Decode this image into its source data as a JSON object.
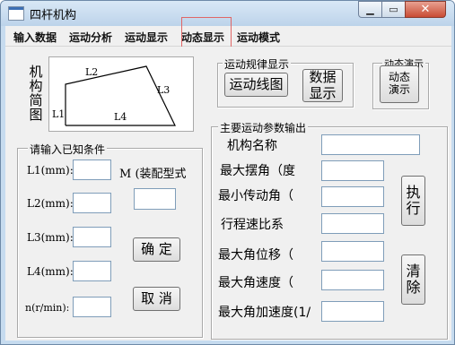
{
  "window": {
    "title": "四杆机构",
    "controls": {
      "minimize_icon": "minimize-icon",
      "maximize_icon": "maximize-icon",
      "close_icon": "close-icon"
    }
  },
  "menu": {
    "items": [
      "输入数据",
      "运动分析",
      "运动显示",
      "动态显示",
      "运动模式"
    ],
    "highlighted": "动态显示"
  },
  "diagram": {
    "side_label": "机构简图",
    "link_labels": [
      "L1",
      "L2",
      "L3",
      "L4"
    ]
  },
  "input_group": {
    "title": "请输入已知条件",
    "fields": [
      {
        "label": "L1(mm):",
        "value": ""
      },
      {
        "label": "L2(mm):",
        "value": ""
      },
      {
        "label": "L3(mm):",
        "value": ""
      },
      {
        "label": "L4(mm):",
        "value": ""
      },
      {
        "label": "n(r/min):",
        "value": ""
      }
    ],
    "mode_label": "M (装配型式",
    "mode_value": "",
    "confirm_button": "确 定",
    "cancel_button": "取 消"
  },
  "motion_law_group": {
    "title": "运动规律显示",
    "line_button": "运动线图",
    "data_button": "数据\n显示"
  },
  "dynamic_group": {
    "title": "动态演示",
    "button": "动态演示"
  },
  "output_group": {
    "title": "主要运动参数输出",
    "rows": [
      {
        "label": "机构名称",
        "value": ""
      },
      {
        "label": "最大摆角（度",
        "value": ""
      },
      {
        "label": "最小传动角（",
        "value": ""
      },
      {
        "label": "行程速比系",
        "value": ""
      },
      {
        "label": "最大角位移（",
        "value": ""
      },
      {
        "label": "最大角速度（",
        "value": ""
      },
      {
        "label": "最大角加速度(1/",
        "value": ""
      }
    ],
    "execute_button": "执行",
    "clear_button": "清除"
  },
  "colors": {
    "window_frame": "#c6dbef",
    "face": "#f0f0f0",
    "highlight_box": "#e06666",
    "close_button": "#c94b34"
  }
}
